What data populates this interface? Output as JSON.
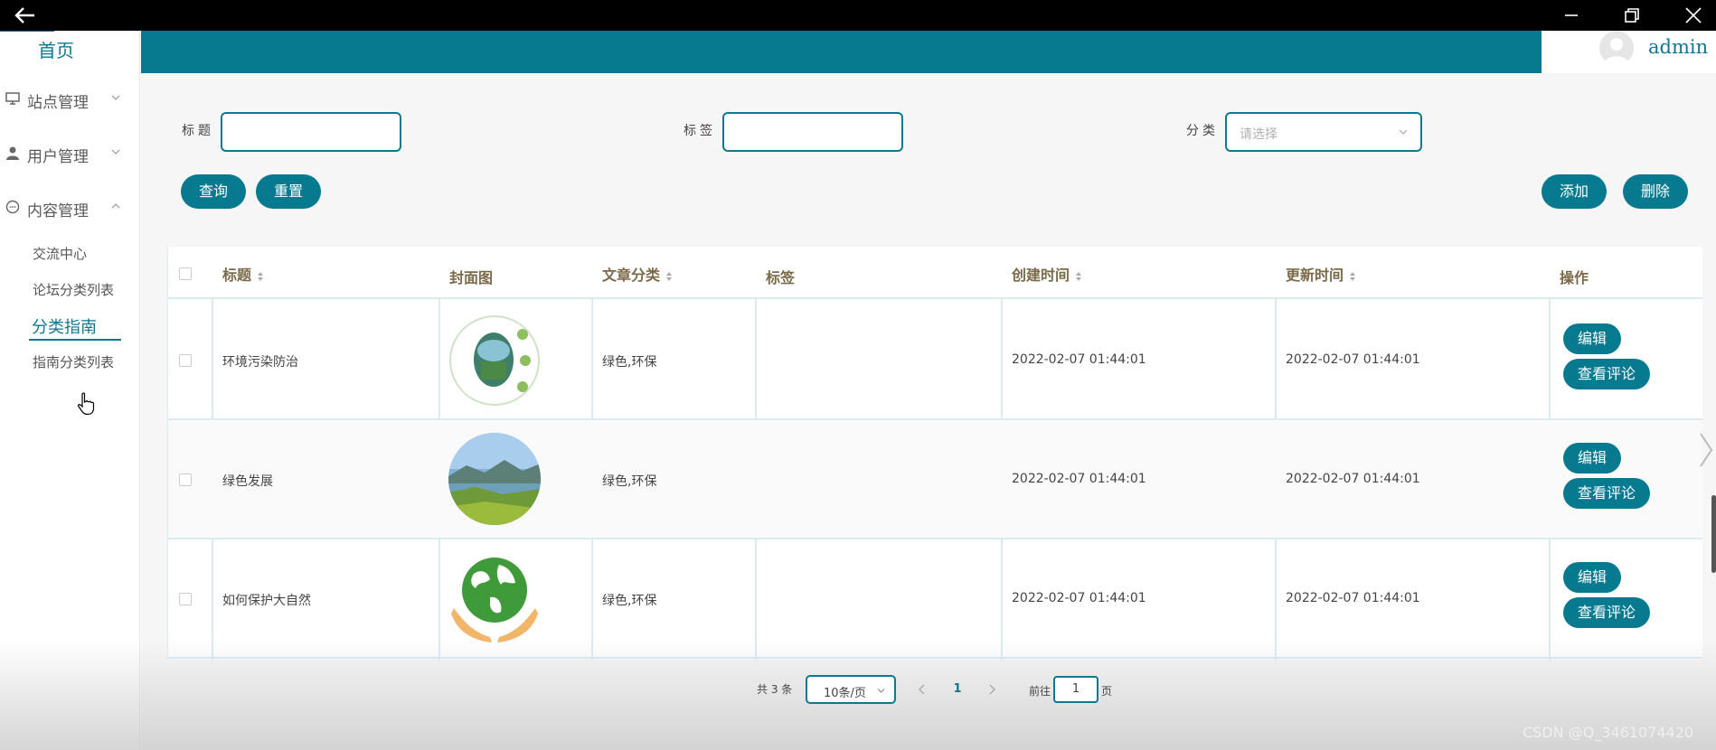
{
  "sidebar": {
    "home": "首页",
    "groups": [
      {
        "label": "站点管理",
        "icon": "monitor-icon"
      },
      {
        "label": "用户管理",
        "icon": "user-icon"
      },
      {
        "label": "内容管理",
        "icon": "chat-icon"
      }
    ],
    "submenu": [
      "交流中心",
      "论坛分类列表",
      "分类指南",
      "指南分类列表"
    ],
    "active_item": "分类指南"
  },
  "header": {
    "username": "admin"
  },
  "filters": {
    "title_label": "标题",
    "tag_label": "标签",
    "category_label": "分类",
    "category_placeholder": "请选择"
  },
  "buttons": {
    "query": "查询",
    "reset": "重置",
    "add": "添加",
    "delete": "删除"
  },
  "table": {
    "headers": [
      "标题",
      "封面图",
      "文章分类",
      "标签",
      "创建时间",
      "更新时间",
      "操作"
    ],
    "rows": [
      {
        "title": "环境污染防治",
        "category": "绿色,环保",
        "tag": "",
        "created": "2022-02-07 01:44:01",
        "updated": "2022-02-07 01:44:01"
      },
      {
        "title": "绿色发展",
        "category": "绿色,环保",
        "tag": "",
        "created": "2022-02-07 01:44:01",
        "updated": "2022-02-07 01:44:01"
      },
      {
        "title": "如何保护大自然",
        "category": "绿色,环保",
        "tag": "",
        "created": "2022-02-07 01:44:01",
        "updated": "2022-02-07 01:44:01"
      }
    ],
    "edit_label": "编辑",
    "view_comments_label": "查看评论"
  },
  "pagination": {
    "total": "共 3 条",
    "page_size": "10条/页",
    "current_page": "1",
    "goto_label": "前往",
    "goto_value": "1",
    "page_unit": "页"
  },
  "watermark": "CSDN @Q_3461074420",
  "colors": {
    "primary": "#077a90",
    "header_text": "#7a6a4a"
  }
}
